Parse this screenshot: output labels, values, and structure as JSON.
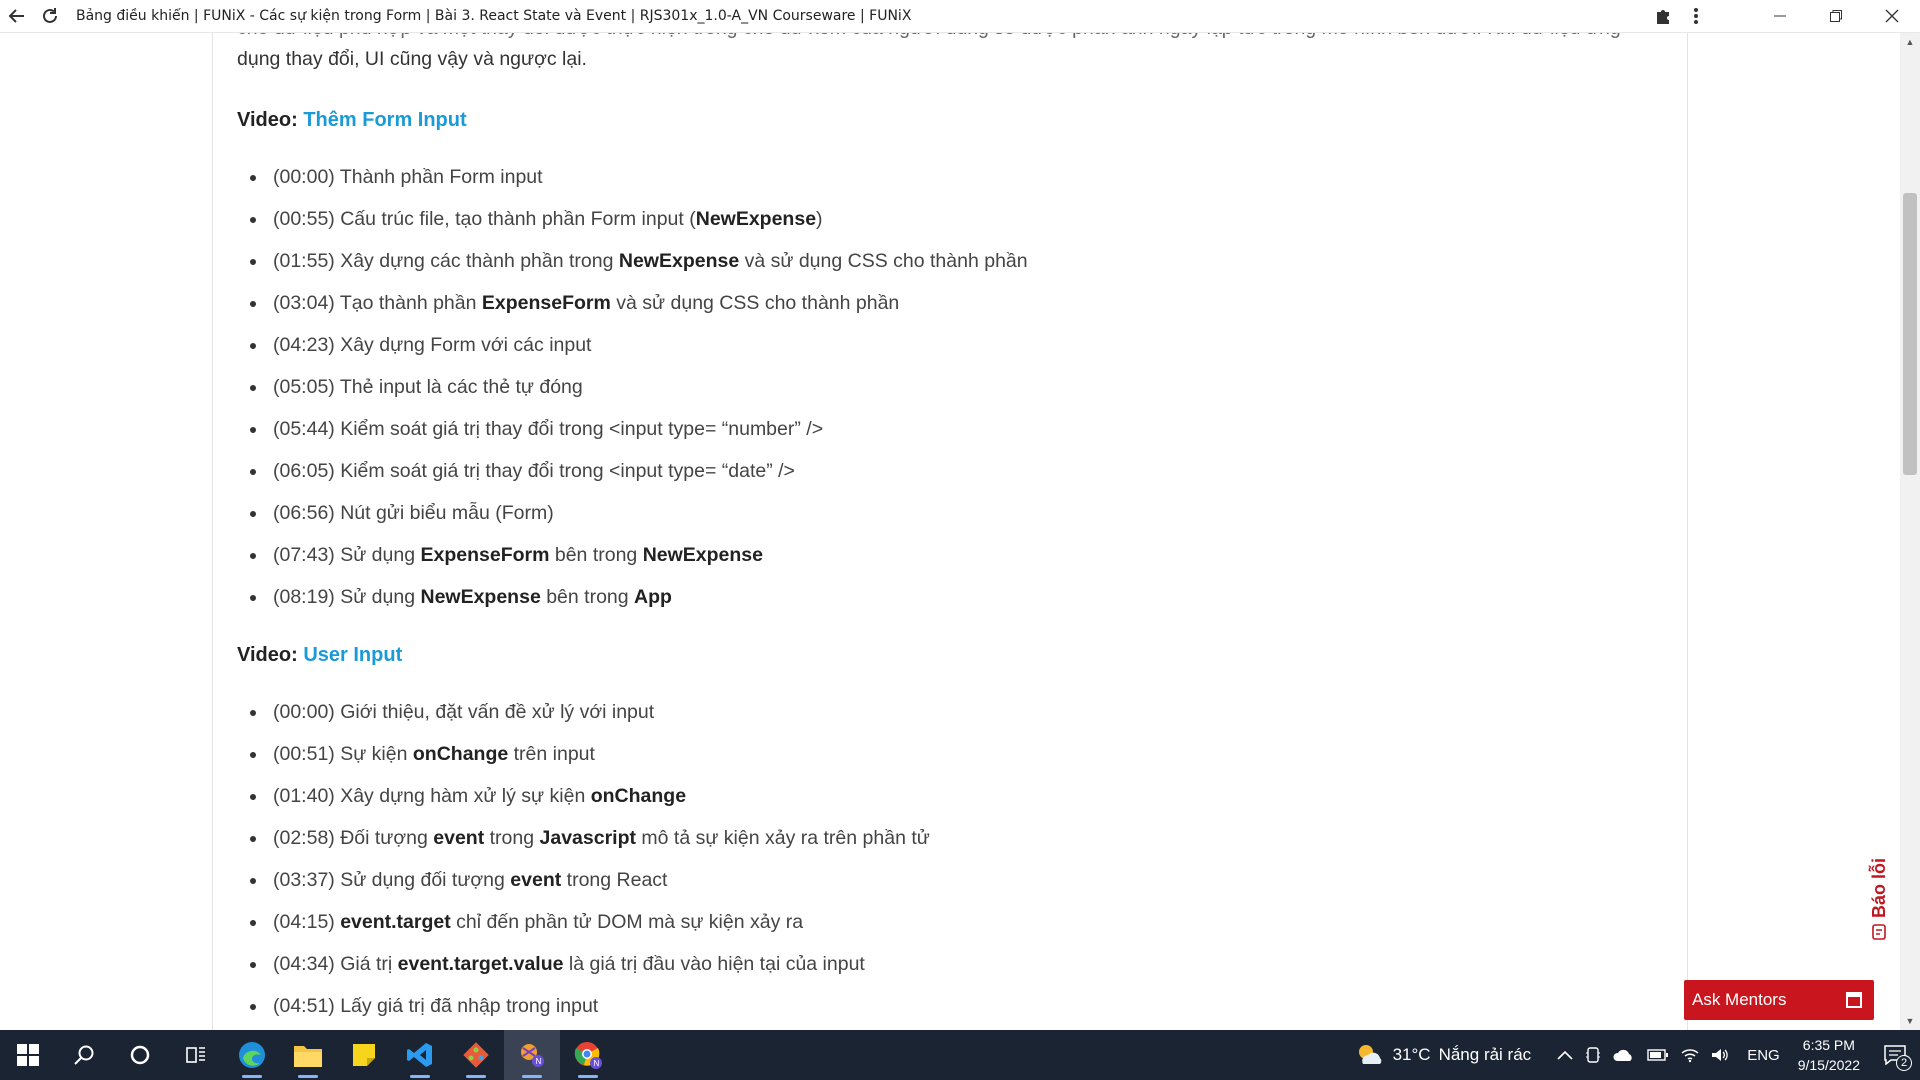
{
  "browser": {
    "title": "Bảng điều khiển | FUNiX - Các sự kiện trong Form | Bài 3. React State và Event | RJS301x_1.0-A_VN Courseware | FUNiX"
  },
  "content": {
    "intro_cut": "cho dữ liệu phù hợp và một thay đổi được thực hiện trong cho dữ xem của người dùng sẽ được phản ánh ngay lập tức trong mô hình bên dưới. Khi dữ liệu ứng",
    "intro_line2": "dụng thay đổi, UI cũng vậy và ngược lại.",
    "video1": {
      "prefix": "Video:",
      "link": "Thêm Form Input",
      "items": [
        {
          "t": "(00:00) Thành phần Form input"
        },
        {
          "t": "(00:55) Cấu trúc file, tạo thành phần Form input (",
          "b": "NewExpense",
          "a": ")"
        },
        {
          "t": "(01:55) Xây dựng các thành phần trong ",
          "b": "NewExpense",
          "a": " và sử dụng CSS cho thành phần"
        },
        {
          "t": "(03:04) Tạo thành phần ",
          "b": "ExpenseForm",
          "a": " và sử dụng CSS cho thành phần"
        },
        {
          "t": "(04:23) Xây dựng Form với các input"
        },
        {
          "t": "(05:05) Thẻ input là các thẻ tự đóng"
        },
        {
          "t": "(05:44) Kiểm soát giá trị thay đổi trong <input type= “number” />"
        },
        {
          "t": "(06:05) Kiểm soát giá trị thay đổi trong <input type= “date” />"
        },
        {
          "t": "(06:56) Nút gửi biểu mẫu (Form)"
        },
        {
          "t": "(07:43) Sử dụng ",
          "b": "ExpenseForm",
          "a": " bên trong ",
          "b2": "NewExpense"
        },
        {
          "t": "(08:19) Sử dụng ",
          "b": "NewExpense",
          "a": " bên trong ",
          "b2": "App"
        }
      ]
    },
    "video2": {
      "prefix": "Video:",
      "link": "User Input",
      "items": [
        {
          "t": "(00:00) Giới thiệu, đặt vấn đề xử lý với input"
        },
        {
          "t": "(00:51) Sự kiện ",
          "b": "onChange",
          "a": " trên input"
        },
        {
          "t": "(01:40) Xây dựng hàm xử lý sự kiện ",
          "b": "onChange"
        },
        {
          "t": "(02:58) Đối tượng ",
          "b": "event",
          "a": " trong ",
          "b2": "Javascript",
          "a2": " mô tả sự kiện xảy ra trên phần tử"
        },
        {
          "t": "(03:37) Sử dụng đối tượng ",
          "b": "event",
          "a": " trong React"
        },
        {
          "t": "(04:15) ",
          "b": "event.target",
          "a": " chỉ đến phần tử DOM mà sự kiện xảy ra"
        },
        {
          "t": "(04:34) Giá trị ",
          "b": "event.target.value",
          "a": " là giá trị đầu vào hiện tại của input"
        },
        {
          "t": "(04:51) Lấy giá trị đã nhập trong input"
        }
      ]
    }
  },
  "widgets": {
    "report_label": "Báo lỗi",
    "ask_mentors": "Ask Mentors"
  },
  "taskbar": {
    "apps": [
      "start",
      "search",
      "cortana",
      "task-view",
      "edge",
      "file-explorer",
      "sticky-notes",
      "vscode",
      "git",
      "node-app",
      "chrome"
    ],
    "weather_temp": "31°C",
    "weather_text": "Nắng rải rác",
    "lang": "ENG",
    "time": "6:35 PM",
    "date": "9/15/2022",
    "notif_count": "2"
  }
}
